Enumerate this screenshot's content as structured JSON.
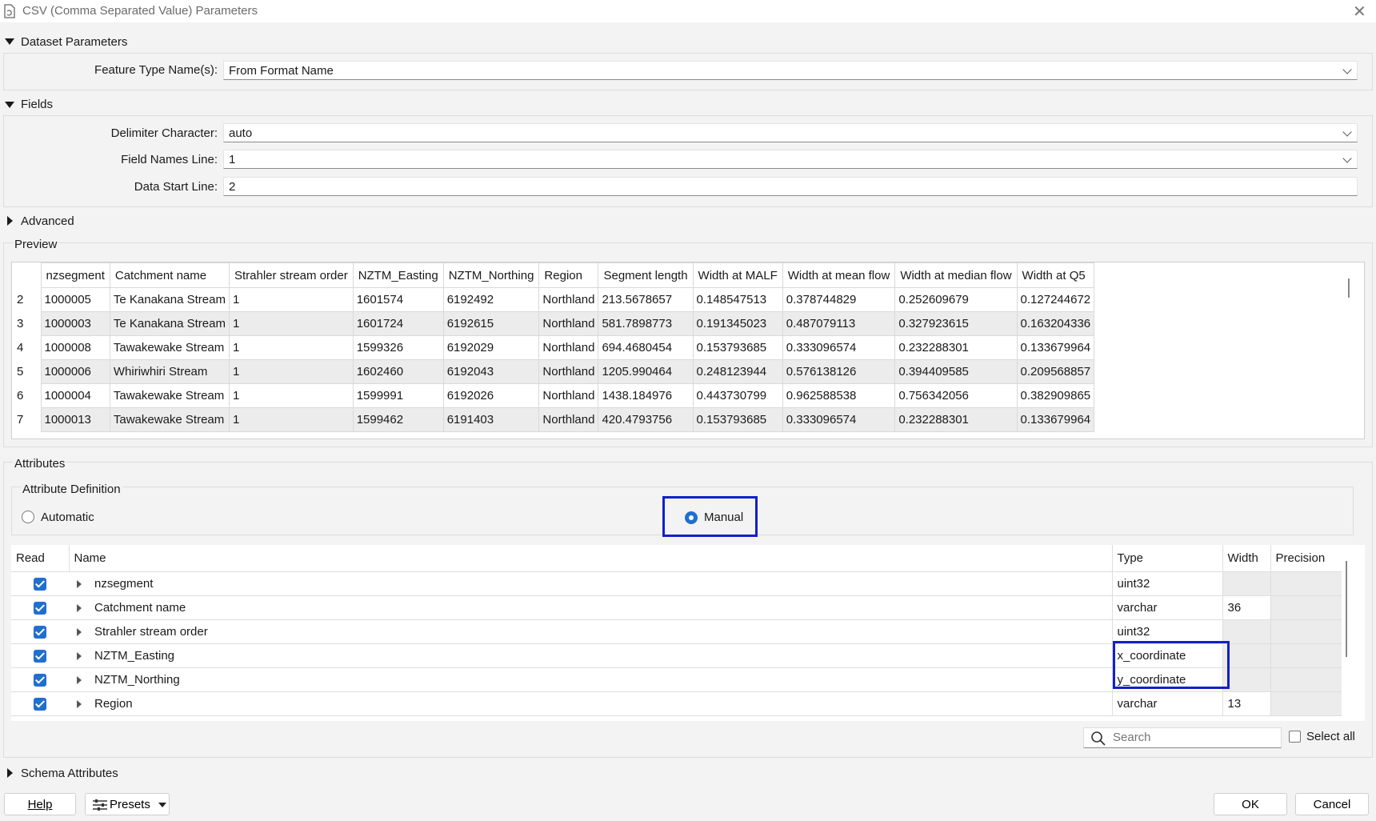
{
  "window": {
    "title": "CSV (Comma Separated Value) Parameters",
    "close_glyph": "✕"
  },
  "dataset": {
    "header": "Dataset Parameters",
    "feature_type_label": "Feature Type Name(s):",
    "feature_type_value": "From Format Name"
  },
  "fields": {
    "header": "Fields",
    "delimiter_label": "Delimiter Character:",
    "delimiter_value": "auto",
    "field_names_label": "Field Names Line:",
    "field_names_value": "1",
    "data_start_label": "Data Start Line:",
    "data_start_value": "2"
  },
  "advanced": {
    "header": "Advanced"
  },
  "preview": {
    "header": "Preview",
    "columns": [
      "nzsegment",
      "Catchment name",
      "Strahler stream order",
      "NZTM_Easting",
      "NZTM_Northing",
      "Region",
      "Segment length",
      "Width at MALF",
      "Width at mean flow",
      "Width at median flow",
      "Width at Q5"
    ],
    "rows": [
      {
        "num": "2",
        "cells": [
          "1000005",
          "Te Kanakana Stream",
          "1",
          "1601574",
          "6192492",
          "Northland",
          "213.5678657",
          "0.148547513",
          "0.378744829",
          "0.252609679",
          "0.127244672"
        ]
      },
      {
        "num": "3",
        "cells": [
          "1000003",
          "Te Kanakana Stream",
          "1",
          "1601724",
          "6192615",
          "Northland",
          "581.7898773",
          "0.191345023",
          "0.487079113",
          "0.327923615",
          "0.163204336"
        ]
      },
      {
        "num": "4",
        "cells": [
          "1000008",
          "Tawakewake Stream",
          "1",
          "1599326",
          "6192029",
          "Northland",
          "694.4680454",
          "0.153793685",
          "0.333096574",
          "0.232288301",
          "0.133679964"
        ]
      },
      {
        "num": "5",
        "cells": [
          "1000006",
          "Whiriwhiri Stream",
          "1",
          "1602460",
          "6192043",
          "Northland",
          "1205.990464",
          "0.248123944",
          "0.576138126",
          "0.394409585",
          "0.209568857"
        ]
      },
      {
        "num": "6",
        "cells": [
          "1000004",
          "Tawakewake Stream",
          "1",
          "1599991",
          "6192026",
          "Northland",
          "1438.184976",
          "0.443730799",
          "0.962588538",
          "0.756342056",
          "0.382909865"
        ]
      },
      {
        "num": "7",
        "cells": [
          "1000013",
          "Tawakewake Stream",
          "1",
          "1599462",
          "6191403",
          "Northland",
          "420.4793756",
          "0.153793685",
          "0.333096574",
          "0.232288301",
          "0.133679964"
        ]
      }
    ]
  },
  "attributes": {
    "header": "Attributes",
    "definition_header": "Attribute Definition",
    "automatic_label": "Automatic",
    "manual_label": "Manual",
    "selected_mode": "Manual",
    "columns": {
      "read": "Read",
      "name": "Name",
      "type": "Type",
      "width": "Width",
      "precision": "Precision"
    },
    "rows": [
      {
        "name": "nzsegment",
        "type": "uint32",
        "width": "",
        "precision": ""
      },
      {
        "name": "Catchment name",
        "type": "varchar",
        "width": "36",
        "precision": ""
      },
      {
        "name": "Strahler stream order",
        "type": "uint32",
        "width": "",
        "precision": ""
      },
      {
        "name": "NZTM_Easting",
        "type": "x_coordinate",
        "width": "",
        "precision": ""
      },
      {
        "name": "NZTM_Northing",
        "type": "y_coordinate",
        "width": "",
        "precision": ""
      },
      {
        "name": "Region",
        "type": "varchar",
        "width": "13",
        "precision": ""
      }
    ],
    "search_placeholder": "Search",
    "select_all_label": "Select all"
  },
  "schema": {
    "header": "Schema Attributes"
  },
  "buttons": {
    "help": "Help",
    "presets": "Presets",
    "ok": "OK",
    "cancel": "Cancel"
  },
  "colors": {
    "highlight": "#1220c8",
    "checkbox": "#1f6fd1",
    "radio": "#1f6fd1"
  }
}
